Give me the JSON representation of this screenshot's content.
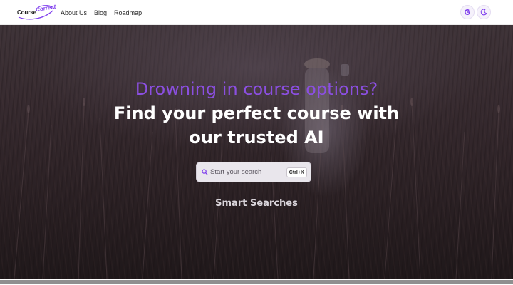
{
  "header": {
    "logo": {
      "part1": "Course",
      "part2": "Correct"
    },
    "nav": [
      "About Us",
      "Blog",
      "Roadmap"
    ],
    "buttons": {
      "google_icon": "google-icon",
      "theme_icon": "moon-icon"
    }
  },
  "hero": {
    "headline_purple": "Drowning in course options?",
    "headline_line1": "Find your perfect course with",
    "headline_line2": "our trusted AI",
    "search": {
      "placeholder": "Start your search",
      "shortcut": "Ctrl+K"
    },
    "smart_searches": "Smart Searches"
  },
  "colors": {
    "accent": "#8b4fe0",
    "brand": "#7c3aed"
  }
}
